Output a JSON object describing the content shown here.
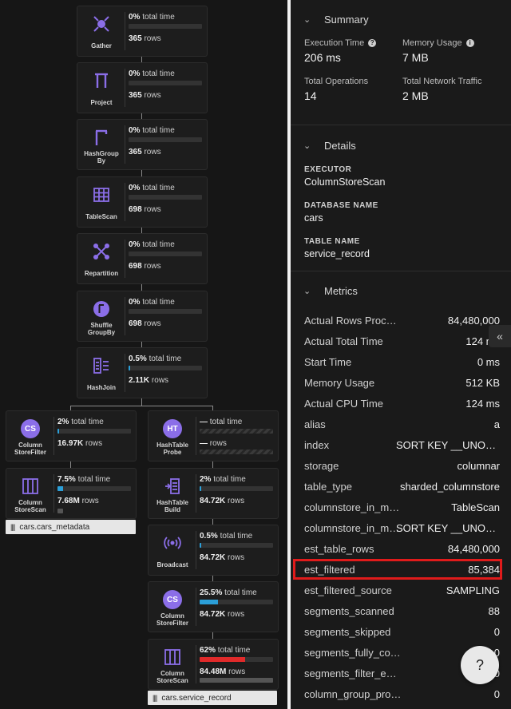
{
  "colors": {
    "accent": "#8b6ee8",
    "progress_blue": "#2b9fd8",
    "progress_red": "#e02a2a",
    "highlight": "#e01b1b"
  },
  "graph": {
    "nodes": [
      {
        "id": "gather",
        "label": "Gather",
        "icon": "gather-icon",
        "pct": "0%",
        "time_label": "total time",
        "rows": "365",
        "rows_label": "rows",
        "progress": 0
      },
      {
        "id": "project",
        "label": "Project",
        "icon": "project-icon",
        "pct": "0%",
        "time_label": "total time",
        "rows": "365",
        "rows_label": "rows",
        "progress": 0
      },
      {
        "id": "hashgroupby",
        "label": "HashGroup By",
        "icon": "hashgroupby-icon",
        "pct": "0%",
        "time_label": "total time",
        "rows": "365",
        "rows_label": "rows",
        "progress": 0
      },
      {
        "id": "tablescan",
        "label": "TableScan",
        "icon": "table-icon",
        "pct": "0%",
        "time_label": "total time",
        "rows": "698",
        "rows_label": "rows",
        "progress": 0
      },
      {
        "id": "repartition",
        "label": "Repartition",
        "icon": "repartition-icon",
        "pct": "0%",
        "time_label": "total time",
        "rows": "698",
        "rows_label": "rows",
        "progress": 0
      },
      {
        "id": "shufflegroupby",
        "label": "Shuffle GroupBy",
        "icon": "shufflegroupby-icon",
        "pct": "0%",
        "time_label": "total time",
        "rows": "698",
        "rows_label": "rows",
        "progress": 0
      },
      {
        "id": "hashjoin",
        "label": "HashJoin",
        "icon": "hashjoin-icon",
        "pct": "0.5%",
        "time_label": "total time",
        "rows": "2.11K",
        "rows_label": "rows",
        "progress": 0.005
      },
      {
        "id": "csf_left",
        "label": "Column StoreFilter",
        "icon": "CS",
        "pct": "2%",
        "time_label": "total time",
        "rows": "16.97K",
        "rows_label": "rows",
        "progress": 0.02
      },
      {
        "id": "htprobe",
        "label": "HashTable Probe",
        "icon": "HT",
        "pct": "—",
        "time_label": "total time",
        "rows": "—",
        "rows_label": "rows",
        "progress": null
      },
      {
        "id": "css_left",
        "label": "Column StoreScan",
        "icon": "columnstore-icon",
        "pct": "7.5%",
        "time_label": "total time",
        "rows": "7.68M",
        "rows_label": "rows",
        "progress": 0.075
      },
      {
        "id": "htbuild",
        "label": "HashTable Build",
        "icon": "hashtable-build-icon",
        "pct": "2%",
        "time_label": "total time",
        "rows": "84.72K",
        "rows_label": "rows",
        "progress": 0.02
      },
      {
        "id": "broadcast",
        "label": "Broadcast",
        "icon": "broadcast-icon",
        "pct": "0.5%",
        "time_label": "total time",
        "rows": "84.72K",
        "rows_label": "rows",
        "progress": 0.005
      },
      {
        "id": "csf_right",
        "label": "Column StoreFilter",
        "icon": "CS",
        "pct": "25.5%",
        "time_label": "total time",
        "rows": "84.72K",
        "rows_label": "rows",
        "progress": 0.255
      },
      {
        "id": "css_right",
        "label": "Column StoreScan",
        "icon": "columnstore-icon",
        "pct": "62%",
        "time_label": "total time",
        "rows": "84.48M",
        "rows_label": "rows",
        "progress": 0.62
      }
    ],
    "tables": {
      "left": "cars.cars_metadata",
      "right": "cars.service_record"
    }
  },
  "summary": {
    "heading": "Summary",
    "exec_time_label": "Execution Time",
    "exec_time": "206 ms",
    "memory_label": "Memory Usage",
    "memory": "7 MB",
    "ops_label": "Total Operations",
    "ops": "14",
    "net_label": "Total Network Traffic",
    "net": "2 MB"
  },
  "details": {
    "heading": "Details",
    "executor_label": "EXECUTOR",
    "executor": "ColumnStoreScan",
    "db_label": "DATABASE NAME",
    "db": "cars",
    "table_label": "TABLE NAME",
    "table": "service_record"
  },
  "metrics": {
    "heading": "Metrics",
    "rows": [
      {
        "k": "Actual Rows Processed",
        "v": "84,480,000"
      },
      {
        "k": "Actual Total Time",
        "v": "124 ms"
      },
      {
        "k": "Start Time",
        "v": "0 ms"
      },
      {
        "k": "Memory Usage",
        "v": "512 KB"
      },
      {
        "k": "Actual CPU Time",
        "v": "124 ms"
      },
      {
        "k": "alias",
        "v": "a"
      },
      {
        "k": "index",
        "v": "SORT KEY __UNORDERED"
      },
      {
        "k": "storage",
        "v": "columnar"
      },
      {
        "k": "table_type",
        "v": "sharded_columnstore"
      },
      {
        "k": "columnstore_in_memory_scan_type",
        "v": "TableScan"
      },
      {
        "k": "columnstore_in_memory_scan_index",
        "v": "SORT KEY __UNORDERED"
      },
      {
        "k": "est_table_rows",
        "v": "84,480,000"
      },
      {
        "k": "est_filtered",
        "v": "85,384"
      },
      {
        "k": "est_filtered_source",
        "v": "SAMPLING"
      },
      {
        "k": "segments_scanned",
        "v": "88"
      },
      {
        "k": "segments_skipped",
        "v": "0"
      },
      {
        "k": "segments_fully_contained",
        "v": "0"
      },
      {
        "k": "segments_filter_encoded_data",
        "v": "0"
      },
      {
        "k": "column_group_probes",
        "v": "0"
      }
    ]
  },
  "controls": {
    "collapse": "«",
    "help": "?"
  }
}
